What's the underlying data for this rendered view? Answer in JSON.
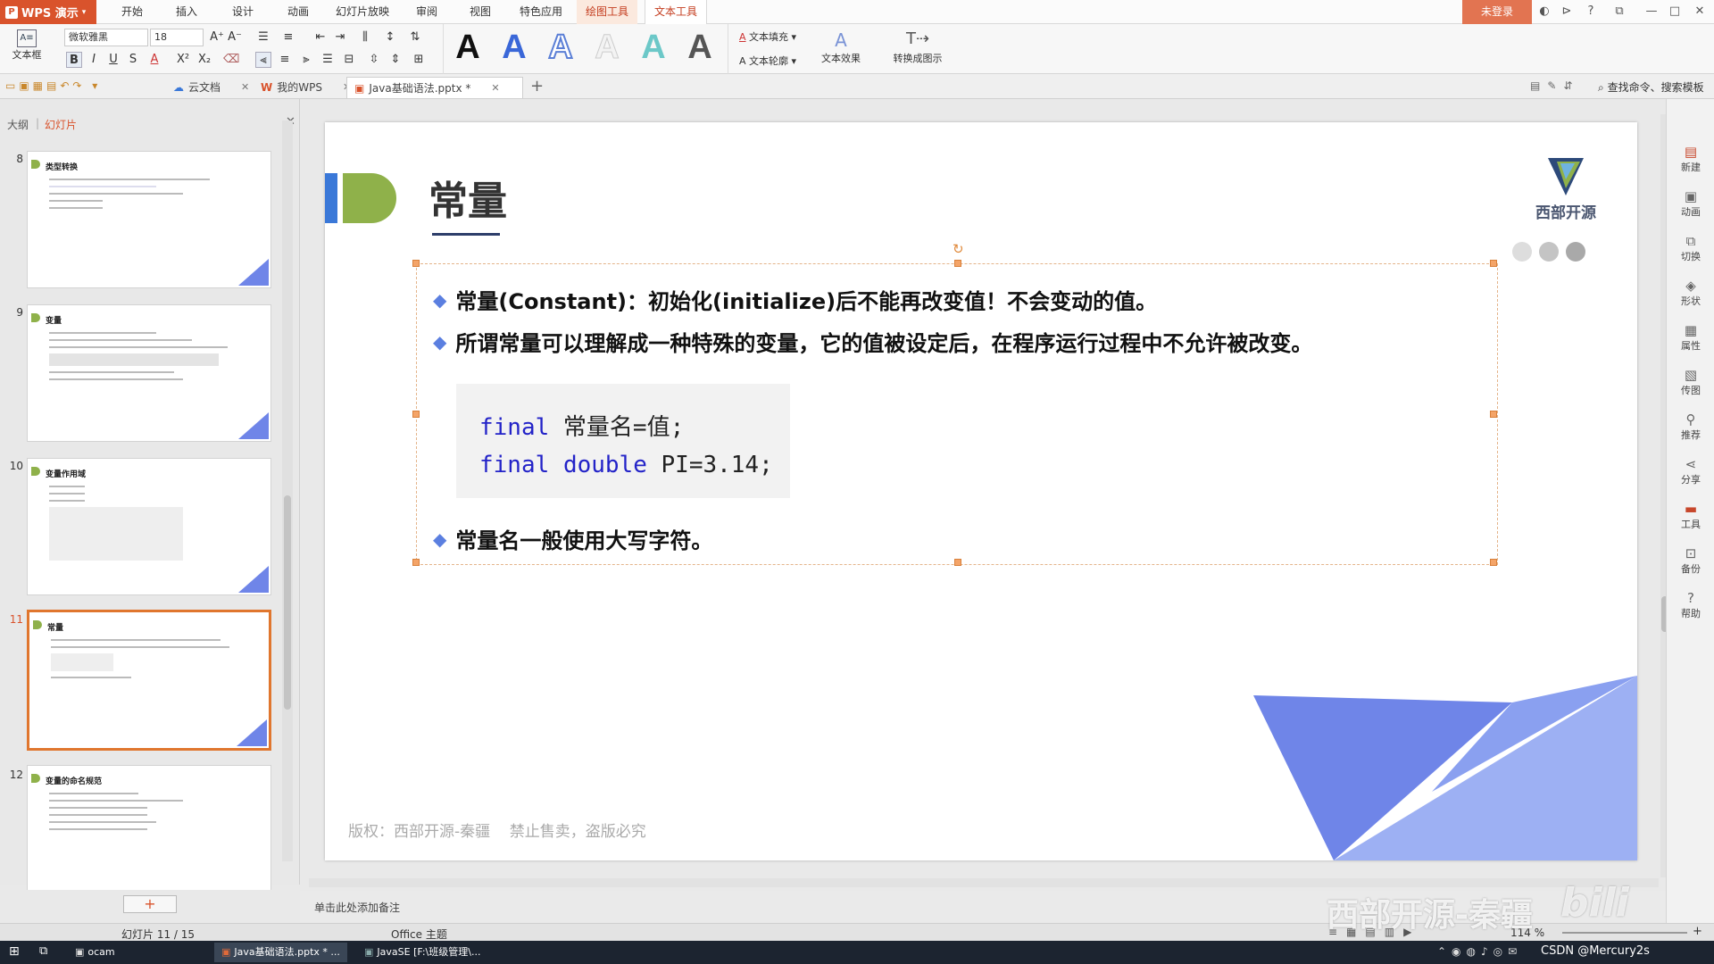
{
  "app": {
    "name": "WPS 演示",
    "login": "未登录"
  },
  "menu": [
    "开始",
    "插入",
    "设计",
    "动画",
    "幻灯片放映",
    "审阅",
    "视图",
    "特色应用",
    "绘图工具",
    "文本工具"
  ],
  "ribbon": {
    "textbox_label": "文本框",
    "font_name": "微软雅黑",
    "font_size": "18",
    "text_fill": "文本填充",
    "text_outline": "文本轮廓",
    "text_effect": "文本效果",
    "convert_art": "转换成图示",
    "bold": "B",
    "italic": "I",
    "underline": "U",
    "strike": "S"
  },
  "tabs": [
    {
      "label": "云文档"
    },
    {
      "label": "我的WPS"
    },
    {
      "label": "Java基础语法.pptx *"
    }
  ],
  "quick_search": "查找命令、搜索模板",
  "left_panel": {
    "outline_tab": "大纲",
    "slides_tab": "幻灯片"
  },
  "thumbnails": [
    {
      "num": "8",
      "title": "类型转换"
    },
    {
      "num": "9",
      "title": "变量"
    },
    {
      "num": "10",
      "title": "变量作用域"
    },
    {
      "num": "11",
      "title": "常量"
    },
    {
      "num": "12",
      "title": "变量的命名规范"
    }
  ],
  "slide": {
    "title": "常量",
    "brand": "西部开源",
    "bullet1": "常量(Constant)：初始化(initialize)后不能再改变值！不会变动的值。",
    "bullet2": "所谓常量可以理解成一种特殊的变量，它的值被设定后，在程序运行过程中不允许被改变。",
    "code_kw1": "final",
    "code_rest1": " 常量名=值;",
    "code_kw2": "final",
    "code_kw3": "double",
    "code_rest2": " PI=3.14;",
    "bullet3": "常量名一般使用大写字符。",
    "footer": "版权：西部开源-秦疆    禁止售卖，盗版必究"
  },
  "notes_placeholder": "单击此处添加备注",
  "status": {
    "slide_count": "幻灯片 11 / 15",
    "theme": "Office 主题",
    "zoom": "114 %"
  },
  "right_bar": [
    "新建",
    "动画",
    "切换",
    "形状",
    "属性",
    "传图",
    "推荐",
    "分享",
    "工具",
    "备份",
    "帮助"
  ],
  "taskbar": {
    "items": [
      "ocam",
      "Java基础语法.pptx * ...",
      "JavaSE [F:\\班级管理\\..."
    ],
    "watermark": "西部开源-秦疆",
    "csdn": "CSDN @Mercury2s"
  },
  "colors": {
    "accent": "#d9532c",
    "slide_blue": "#6f85e8",
    "brand_green": "#8fb14a",
    "code_kw": "#2323c8"
  }
}
